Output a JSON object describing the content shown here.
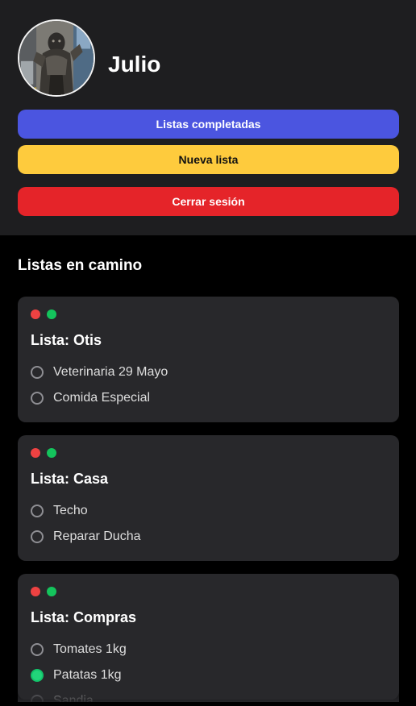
{
  "profile": {
    "name": "Julio",
    "avatar_icon": "statue-photo-avatar"
  },
  "buttons": {
    "completed_label": "Listas completadas",
    "completed_color": "#4b55e0",
    "new_label": "Nueva lista",
    "new_color": "#fecb3d",
    "logout_label": "Cerrar sesión",
    "logout_color": "#e52429"
  },
  "section": {
    "title": "Listas en camino"
  },
  "status_colors": {
    "red": "#ee4242",
    "green": "#14c45c",
    "checked": "#22d47a"
  },
  "lists": [
    {
      "title": "Lista: Otis",
      "items": [
        {
          "label": "Veterinaria 29 Mayo",
          "checked": false
        },
        {
          "label": "Comida Especial",
          "checked": false
        }
      ]
    },
    {
      "title": "Lista: Casa",
      "items": [
        {
          "label": "Techo",
          "checked": false
        },
        {
          "label": "Reparar Ducha",
          "checked": false
        }
      ]
    },
    {
      "title": "Lista: Compras",
      "items": [
        {
          "label": "Tomates 1kg",
          "checked": false
        },
        {
          "label": "Patatas 1kg",
          "checked": true
        },
        {
          "label": "Sandia",
          "checked": false
        }
      ]
    }
  ]
}
